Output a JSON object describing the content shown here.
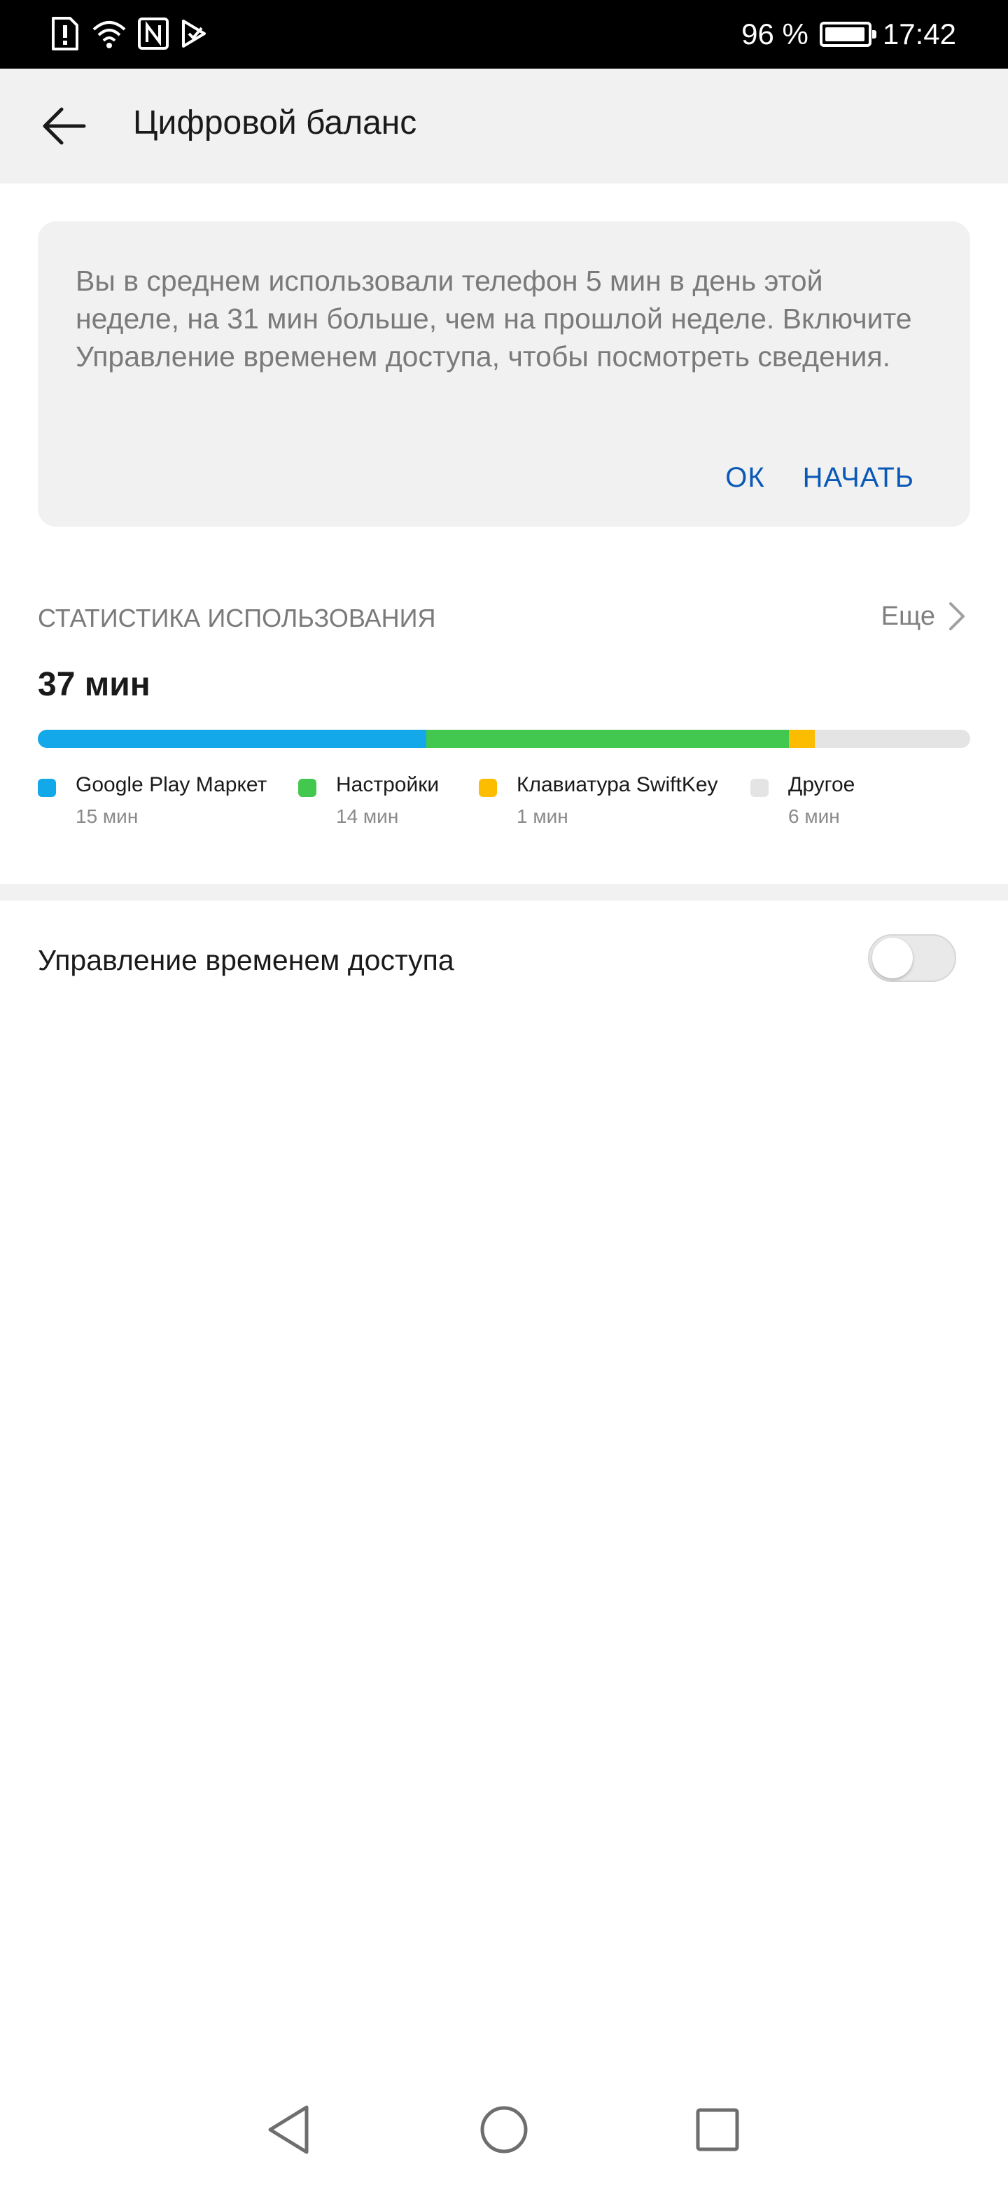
{
  "status_bar": {
    "battery_text": "96 %",
    "time": "17:42",
    "icons": [
      "sim-alert-icon",
      "wifi-icon",
      "nfc-icon",
      "play-protect-icon"
    ]
  },
  "app_bar": {
    "title": "Цифровой баланс",
    "back_icon": "arrow-left-icon"
  },
  "info_card": {
    "text": "Вы в среднем использовали телефон 5 мин в день этой неделе, на 31 мин больше, чем на прошлой неделе. Включите Управление временем доступа, чтобы посмотреть сведения.",
    "ok_label": "ОК",
    "start_label": "НАЧАТЬ"
  },
  "usage": {
    "header": "СТАТИСТИКА ИСПОЛЬЗОВАНИЯ",
    "more_label": "Еще",
    "total": "37 мин",
    "items": [
      {
        "name": "Google Play Маркет",
        "time": "15 мин",
        "minutes": 15,
        "color": "#12a8ea"
      },
      {
        "name": "Настройки",
        "time": "14 мин",
        "minutes": 14,
        "color": "#43c84f"
      },
      {
        "name": "Клавиатура SwiftKey",
        "time": "1 мин",
        "minutes": 1,
        "color": "#fcbc00"
      },
      {
        "name": "Другое",
        "time": "6 мин",
        "minutes": 6,
        "color": "#e4e4e4"
      }
    ]
  },
  "screen_time_management": {
    "label": "Управление временем доступа",
    "enabled": false
  },
  "nav_bar": {
    "icons": [
      "back-triangle-icon",
      "home-circle-icon",
      "recents-square-icon"
    ]
  }
}
